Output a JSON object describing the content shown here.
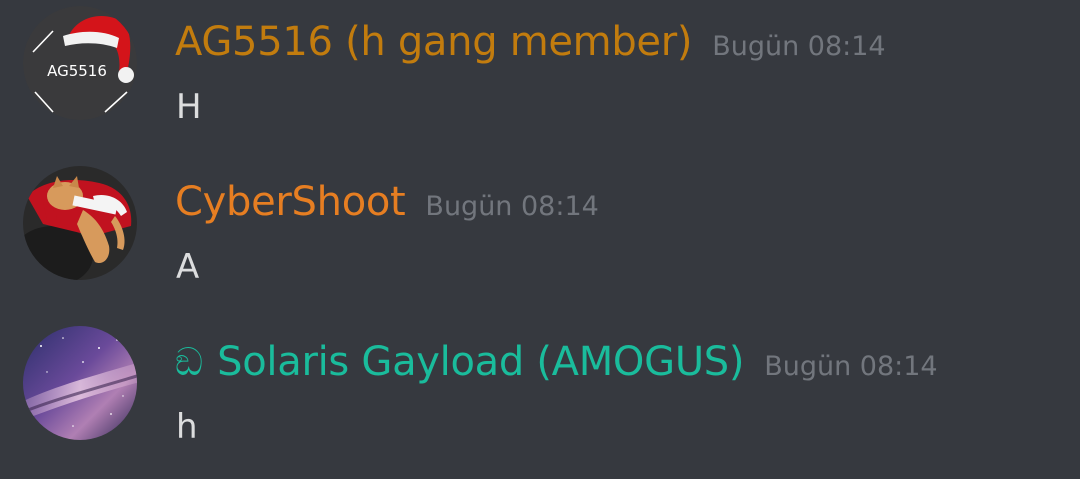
{
  "messages": [
    {
      "username": "AG5516 (h gang member)",
      "username_color": "#c27c0e",
      "timestamp": "Bugün 08:14",
      "content": "H",
      "avatar": {
        "icon": "santa-hat-logo-icon",
        "text": "AG5516"
      }
    },
    {
      "username": "CyberShoot",
      "username_color": "#e67e22",
      "timestamp": "Bugün 08:14",
      "content": "A",
      "avatar": {
        "icon": "cat-in-santa-outfit-avatar"
      }
    },
    {
      "username": "Solaris Gayload (AMOGUS)",
      "username_color": "#1abc9c",
      "role_icon": "ඞ",
      "timestamp": "Bugün 08:14",
      "content": "h",
      "avatar": {
        "icon": "galaxy-milky-way-avatar"
      }
    }
  ]
}
